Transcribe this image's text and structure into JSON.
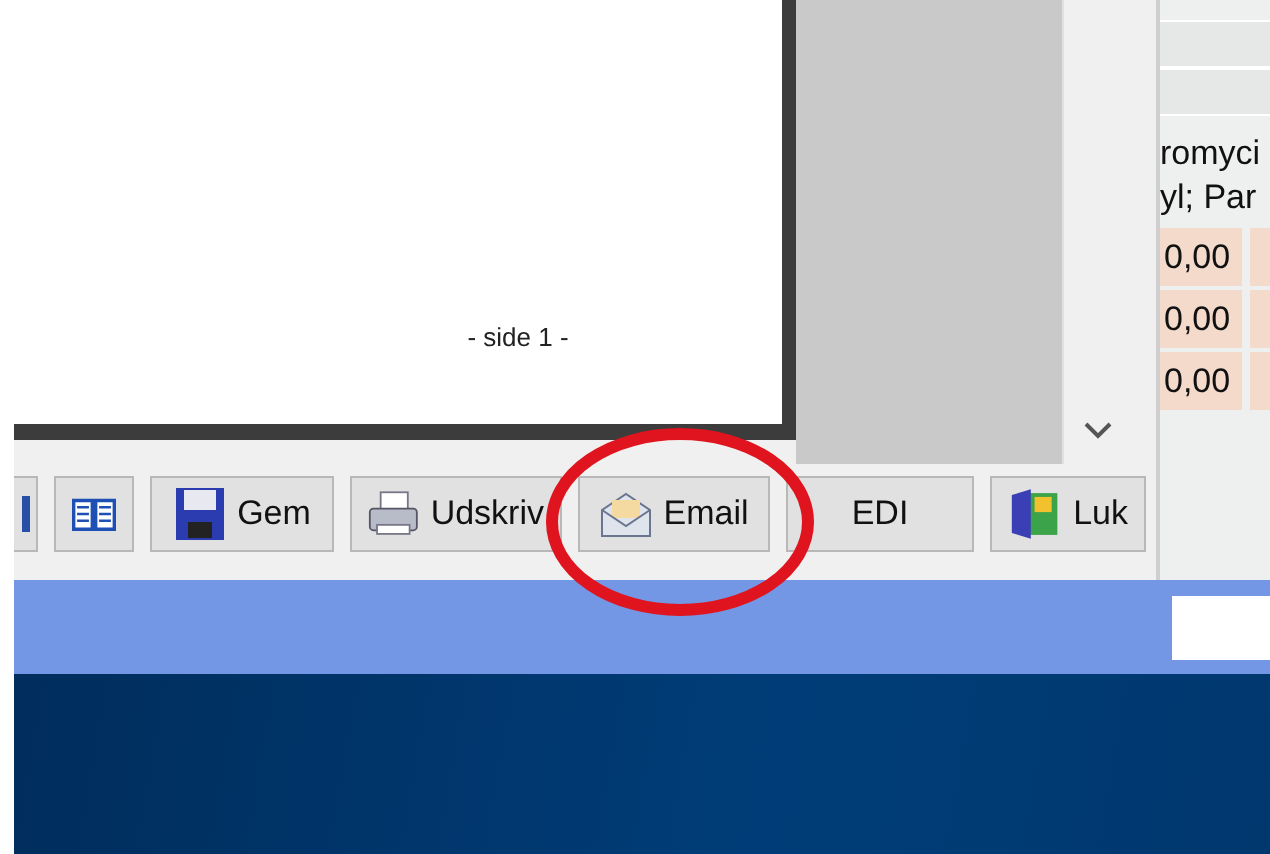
{
  "preview": {
    "page_label": "- side 1 -"
  },
  "side_table": {
    "header_lines": [
      "romyci",
      "yl; Par"
    ],
    "rows": [
      {
        "amount": "0,00"
      },
      {
        "amount": "0,00"
      },
      {
        "amount": "0,00"
      }
    ]
  },
  "toolbar": {
    "buttons": [
      {
        "kind": "partial"
      },
      {
        "kind": "book"
      },
      {
        "kind": "save",
        "label": "Gem"
      },
      {
        "kind": "print",
        "label": "Udskriv"
      },
      {
        "kind": "email",
        "label": "Email"
      },
      {
        "kind": "text",
        "label": "EDI"
      },
      {
        "kind": "exit",
        "label": "Luk"
      }
    ]
  }
}
